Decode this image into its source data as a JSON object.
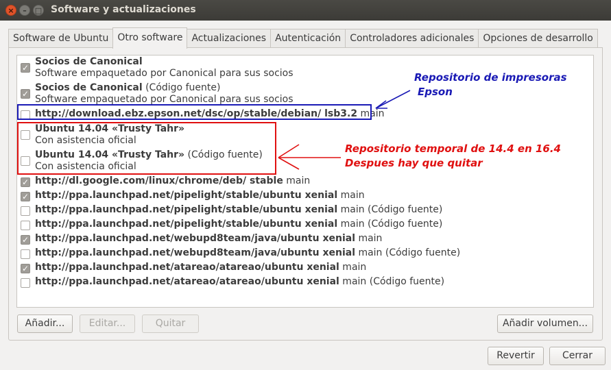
{
  "window": {
    "title": "Software y actualizaciones",
    "close_glyph": "×",
    "minimize_glyph": "–",
    "maximize_glyph": "□"
  },
  "tabs": [
    {
      "label": "Software de Ubuntu",
      "active": false
    },
    {
      "label": "Otro software",
      "active": true
    },
    {
      "label": "Actualizaciones",
      "active": false
    },
    {
      "label": "Autenticación",
      "active": false
    },
    {
      "label": "Controladores adicionales",
      "active": false
    },
    {
      "label": "Opciones de desarrollo",
      "active": false
    }
  ],
  "sources": [
    {
      "checked": true,
      "bold": "Socios de Canonical",
      "rest": "",
      "sub": "Software empaquetado por Canonical para sus socios"
    },
    {
      "checked": true,
      "bold": "Socios de Canonical",
      "rest": " (Código fuente)",
      "sub": "Software empaquetado por Canonical para sus socios"
    },
    {
      "checked": false,
      "bold": "http://download.ebz.epson.net/dsc/op/stable/debian/ lsb3.2",
      "rest": " main",
      "sub": ""
    },
    {
      "checked": false,
      "bold": "Ubuntu 14.04 «Trusty Tahr»",
      "rest": "",
      "sub": "Con asistencia oficial"
    },
    {
      "checked": false,
      "bold": "Ubuntu 14.04 «Trusty Tahr»",
      "rest": " (Código fuente)",
      "sub": "Con asistencia oficial"
    },
    {
      "checked": true,
      "bold": "http://dl.google.com/linux/chrome/deb/ stable",
      "rest": " main",
      "sub": ""
    },
    {
      "checked": true,
      "bold": "http://ppa.launchpad.net/pipelight/stable/ubuntu xenial",
      "rest": " main",
      "sub": ""
    },
    {
      "checked": false,
      "bold": "http://ppa.launchpad.net/pipelight/stable/ubuntu xenial",
      "rest": " main (Código fuente)",
      "sub": ""
    },
    {
      "checked": false,
      "bold": "http://ppa.launchpad.net/pipelight/stable/ubuntu xenial",
      "rest": " main (Código fuente)",
      "sub": ""
    },
    {
      "checked": true,
      "bold": "http://ppa.launchpad.net/webupd8team/java/ubuntu xenial",
      "rest": " main",
      "sub": ""
    },
    {
      "checked": false,
      "bold": "http://ppa.launchpad.net/webupd8team/java/ubuntu xenial",
      "rest": " main (Código fuente)",
      "sub": ""
    },
    {
      "checked": true,
      "bold": "http://ppa.launchpad.net/atareao/atareao/ubuntu xenial",
      "rest": " main",
      "sub": ""
    },
    {
      "checked": false,
      "bold": "http://ppa.launchpad.net/atareao/atareao/ubuntu xenial",
      "rest": " main (Código fuente)",
      "sub": ""
    }
  ],
  "checkbox_glyph": "✓",
  "buttons": {
    "add": "Añadir...",
    "edit": "Editar...",
    "remove": "Quitar",
    "add_volume": "Añadir volumen...",
    "revert": "Revertir",
    "close": "Cerrar"
  },
  "annotations": {
    "epson_line1": "Repositorio de impresoras",
    "epson_line2": "Epson",
    "temp_line1": "Repositorio temporal de 14.4 en 16.4",
    "temp_line2": "Despues hay que quitar",
    "epson_color": "#1a1ab5",
    "temp_color": "#e01010"
  },
  "colors": {
    "titlebar": "#3c3b37",
    "window_bg": "#f2f1f0",
    "close_button": "#e0532a"
  }
}
